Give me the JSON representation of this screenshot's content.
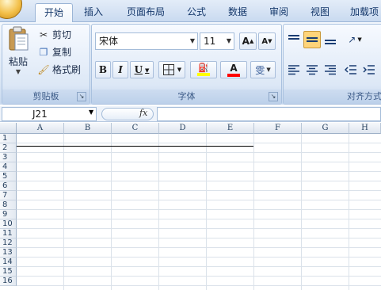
{
  "tabs": [
    {
      "label": "开始",
      "active": true
    },
    {
      "label": "插入",
      "active": false
    },
    {
      "label": "页面布局",
      "active": false
    },
    {
      "label": "公式",
      "active": false
    },
    {
      "label": "数据",
      "active": false
    },
    {
      "label": "审阅",
      "active": false
    },
    {
      "label": "视图",
      "active": false
    },
    {
      "label": "加载项",
      "active": false
    }
  ],
  "clipboard": {
    "paste": "粘贴",
    "cut": "剪切",
    "copy": "复制",
    "format_painter": "格式刷",
    "group_label": "剪贴板"
  },
  "font": {
    "name": "宋体",
    "size": "11",
    "grow": "A",
    "shrink": "A",
    "bold": "B",
    "italic": "I",
    "underline": "U",
    "color_letter": "A",
    "phonetic": "雯",
    "group_label": "字体"
  },
  "alignment": {
    "group_label": "对齐方式"
  },
  "formula_bar": {
    "name_box": "J21",
    "fx": "fx",
    "value": ""
  },
  "grid": {
    "columns": [
      "A",
      "B",
      "C",
      "D",
      "E",
      "F",
      "G",
      "H"
    ],
    "rows": [
      "1",
      "2",
      "3",
      "4",
      "5",
      "6",
      "7",
      "8",
      "9",
      "10",
      "11",
      "12",
      "13",
      "14",
      "15",
      "16"
    ]
  },
  "colors": {
    "ribbon_bg": "#dbe7f5",
    "fill_highlight": "#ffff00",
    "font_color": "#ff0000",
    "active_align": "#ffd47a"
  }
}
